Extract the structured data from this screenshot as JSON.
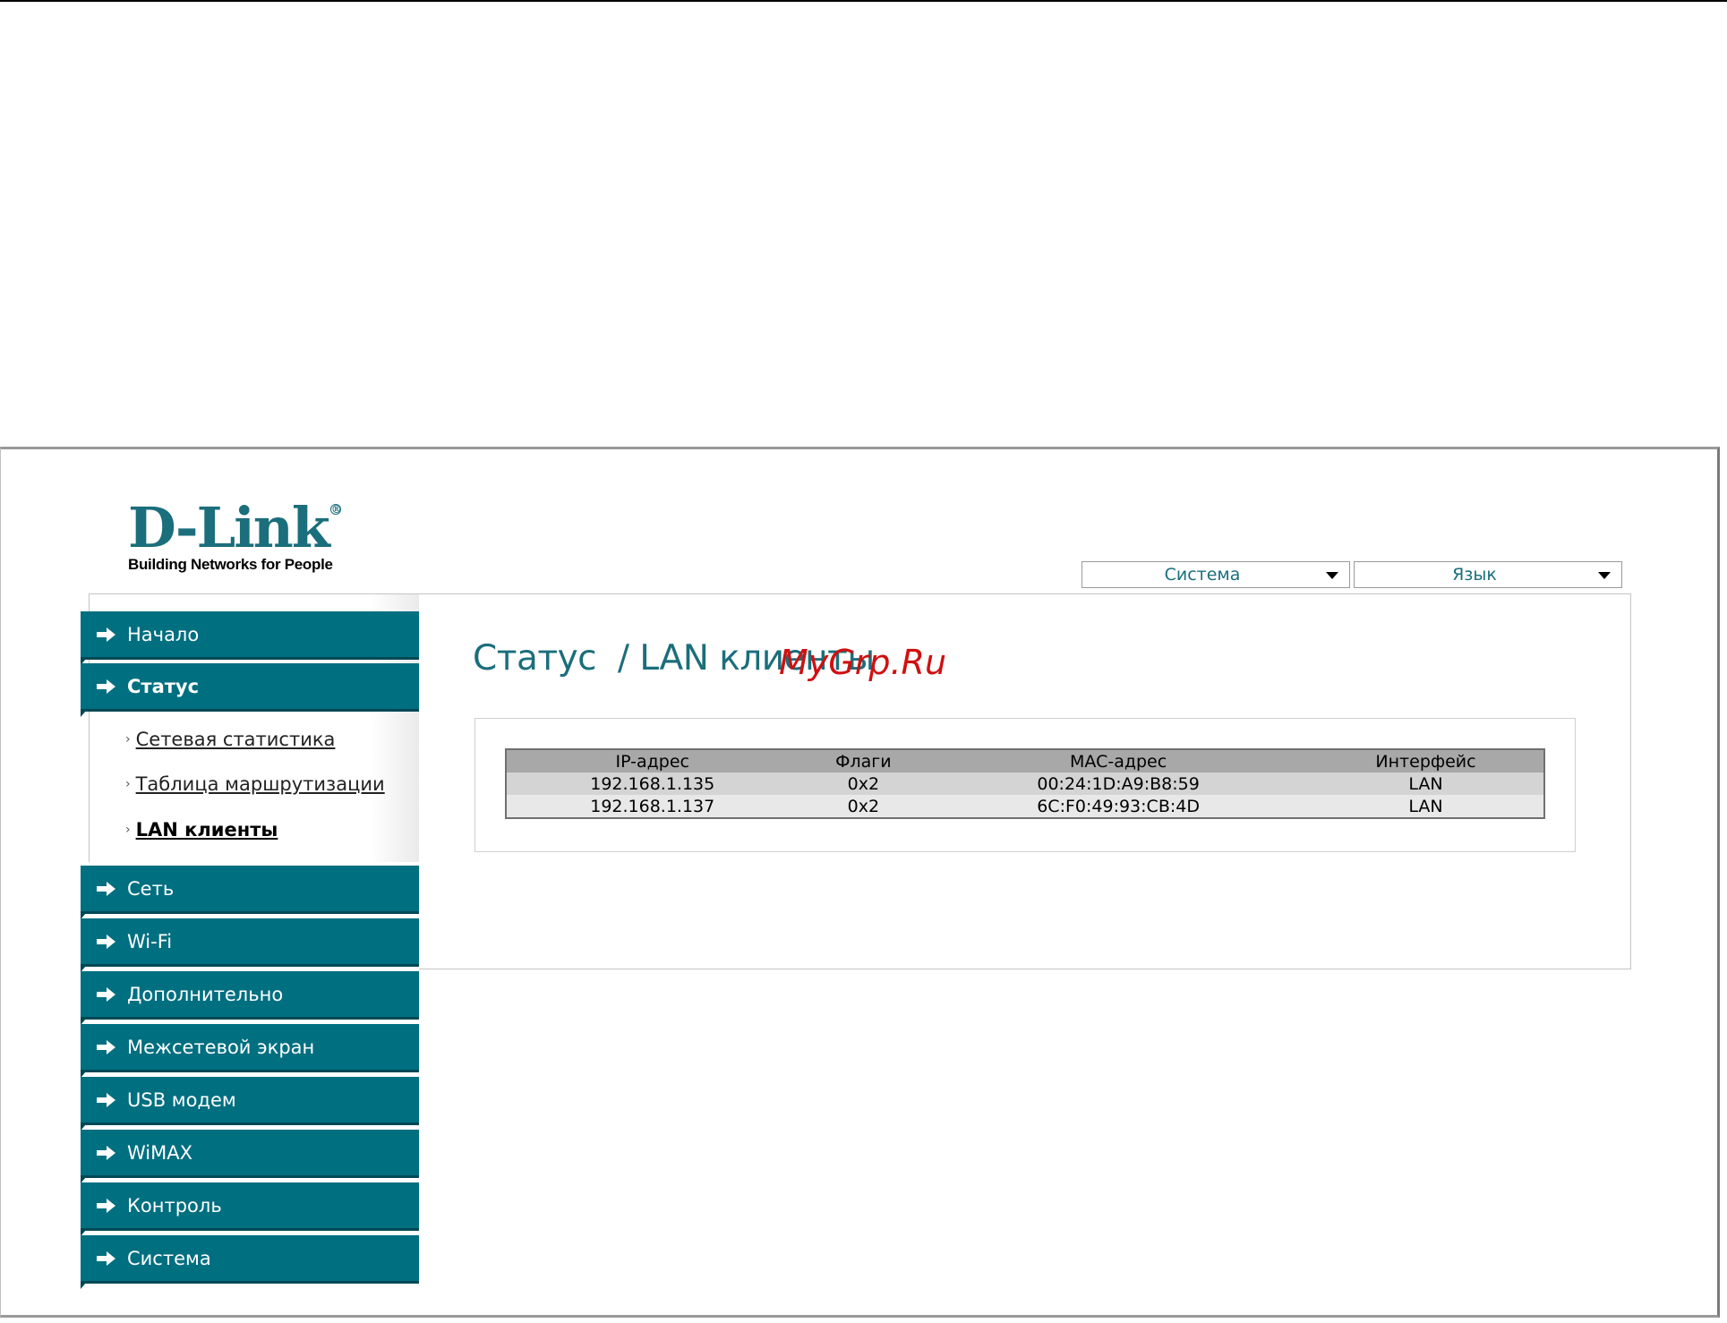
{
  "logo": {
    "brand": "D-Link",
    "tagline": "Building Networks for People"
  },
  "header": {
    "system_menu": "Система",
    "language_menu": "Язык"
  },
  "nav": {
    "items": [
      {
        "label": "Начало"
      },
      {
        "label": "Статус"
      },
      {
        "label": "Сеть"
      },
      {
        "label": "Wi-Fi"
      },
      {
        "label": "Дополнительно"
      },
      {
        "label": "Межсетевой экран"
      },
      {
        "label": "USB модем"
      },
      {
        "label": "WiMAX"
      },
      {
        "label": "Контроль"
      },
      {
        "label": "Система"
      }
    ],
    "status_subitems": [
      {
        "label": "Сетевая статистика"
      },
      {
        "label": "Таблица маршрутизации"
      },
      {
        "label": "LAN клиенты"
      }
    ]
  },
  "page": {
    "title": "Статус  / LAN клиенты",
    "watermark": "MyGrp.Ru"
  },
  "table": {
    "headers": [
      "IP-адрес",
      "Флаги",
      "MAC-адрес",
      "Интерфейс"
    ],
    "rows": [
      [
        "192.168.1.135",
        "0x2",
        "00:24:1D:A9:B8:59",
        "LAN"
      ],
      [
        "192.168.1.137",
        "0x2",
        "6C:F0:49:93:CB:4D",
        "LAN"
      ]
    ]
  },
  "colors": {
    "accent": "#006f80",
    "title": "#1b6e7b",
    "watermark": "#d01010"
  }
}
